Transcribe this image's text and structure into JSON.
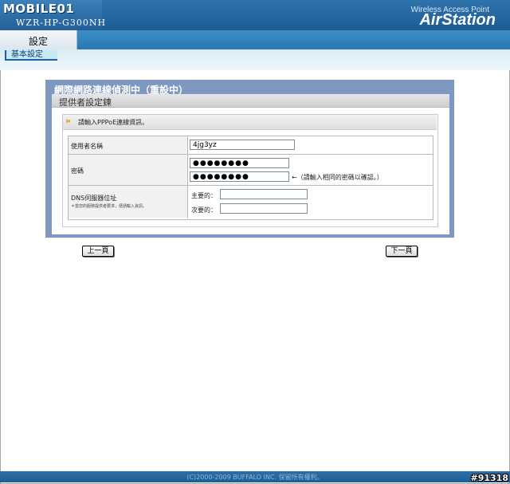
{
  "header": {
    "logo_text": "MOBILE01",
    "model": "WZR-HP-G300NH",
    "brand_sub": "Wireless Access Point",
    "brand": "AirStation"
  },
  "nav": {
    "active_tab": "設定",
    "sub_tab": "基本設定"
  },
  "panel": {
    "title": "網際網路連線偵測中（重設中）",
    "subtitle": "提供者設定鍊",
    "info_icon": "double-chevron-icon",
    "info_text": "請輸入PPPoE連線資訊。"
  },
  "form": {
    "username_label": "使用者名稱",
    "username_value": "4jg3yz",
    "password_label": "密碼",
    "password_value": "●●●●●●●●",
    "password_confirm_value": "●●●●●●●●",
    "confirm_hint": "←（請輸入相同的密碼以確認。）",
    "dns_label": "DNS伺服器位址",
    "dns_note": "＊當您的服務提供者要求，便請輸入資訊。",
    "dns_primary_label": "主要的：",
    "dns_primary_value": "",
    "dns_secondary_label": "次要的：",
    "dns_secondary_value": ""
  },
  "buttons": {
    "prev": "上一頁",
    "next": "下一頁"
  },
  "footer": {
    "copyright": "(C)2000-2009 BUFFALO INC. 保留所有權利。"
  },
  "watermark": "#91318",
  "colors": {
    "header_blue": "#1c5c95",
    "panel_frame": "#7f98c2",
    "accent_orange": "#e58a00"
  }
}
